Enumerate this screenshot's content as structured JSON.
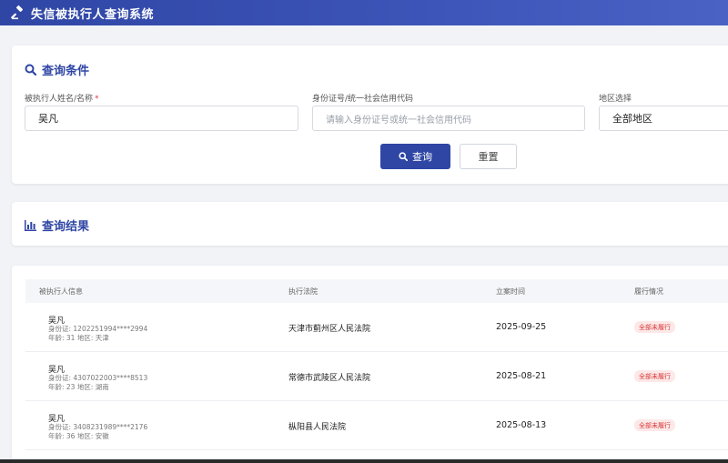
{
  "app": {
    "title": "失信被执行人查询系统",
    "icon": "gavel-icon"
  },
  "search": {
    "section_title": "查询条件",
    "name_label": "被执行人姓名/名称",
    "name_required": "*",
    "name_value": "吴凡",
    "id_label": "身份证号/统一社会信用代码",
    "id_placeholder": "请输入身份证号或统一社会信用代码",
    "region_label": "地区选择",
    "region_value": "全部地区",
    "query_button": "查询",
    "reset_button": "重置"
  },
  "results": {
    "section_title": "查询结果",
    "columns": [
      "被执行人信息",
      "执行法院",
      "立案时间",
      "履行情况"
    ],
    "rows": [
      {
        "name": "吴凡",
        "id": "身份证: 1202251994****2994",
        "meta": "年龄: 31 地区: 天津",
        "court": "天津市蓟州区人民法院",
        "date": "2025-09-25",
        "status": "全部未履行"
      },
      {
        "name": "吴凡",
        "id": "身份证: 4307022003****8513",
        "meta": "年龄: 23 地区: 湖南",
        "court": "常德市武陵区人民法院",
        "date": "2025-08-21",
        "status": "全部未履行"
      },
      {
        "name": "吴凡",
        "id": "身份证: 3408231989****2176",
        "meta": "年龄: 36 地区: 安徽",
        "court": "枞阳县人民法院",
        "date": "2025-08-13",
        "status": "全部未履行"
      }
    ]
  },
  "colors": {
    "primary": "#2f46a5",
    "danger": "#d93636",
    "danger_bg": "#fde8e8"
  }
}
